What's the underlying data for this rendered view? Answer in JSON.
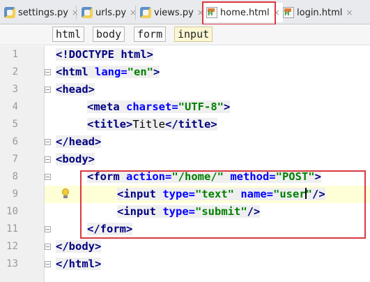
{
  "tabs": [
    {
      "label": "settings.py",
      "kind": "python",
      "close": "×"
    },
    {
      "label": "urls.py",
      "kind": "python",
      "close": "×"
    },
    {
      "label": "views.py",
      "kind": "python",
      "close": "×"
    },
    {
      "label": "home.html",
      "kind": "html",
      "close": "×",
      "active": true
    },
    {
      "label": "login.html",
      "kind": "html",
      "close": "×"
    }
  ],
  "file_icon_letter": "H",
  "breadcrumbs": [
    "html",
    "body",
    "form",
    "input"
  ],
  "line_numbers": [
    "1",
    "2",
    "3",
    "4",
    "5",
    "6",
    "7",
    "8",
    "9",
    "10",
    "11",
    "12",
    "13"
  ],
  "colors": {
    "highlight_box": "#d9393f",
    "tag": "#000080",
    "attribute": "#0000ff",
    "value": "#008000",
    "caret_line": "#ffffd7"
  },
  "code": {
    "l1": {
      "decl": "<!DOCTYPE html>"
    },
    "l2": {
      "open": "<html",
      "attr": " lang=",
      "value": "\"en\"",
      "close": ">"
    },
    "l3": {
      "tag": "<head>"
    },
    "l4": {
      "open": "<meta",
      "attr": " charset=",
      "value": "\"UTF-8\"",
      "close": ">"
    },
    "l5": {
      "open": "<title>",
      "text": "Title",
      "close": "</title>"
    },
    "l6": {
      "tag": "</head>"
    },
    "l7": {
      "tag": "<body>"
    },
    "l8": {
      "open": "<form",
      "attr1": " action=",
      "value1": "\"/home/\"",
      "attr2": " method=",
      "value2": "\"POST\"",
      "close": ">"
    },
    "l9": {
      "open": "<input",
      "attr1": " type=",
      "value1": "\"text\"",
      "attr2": " name=",
      "value2a": "\"user",
      "value2b": "\"",
      "close": "/>"
    },
    "l10": {
      "open": "<input",
      "attr1": " type=",
      "value1": "\"submit\"",
      "close": "/>"
    },
    "l11": {
      "tag": "</form>"
    },
    "l12": {
      "tag": "</body>"
    },
    "l13": {
      "tag": "</html>"
    }
  }
}
